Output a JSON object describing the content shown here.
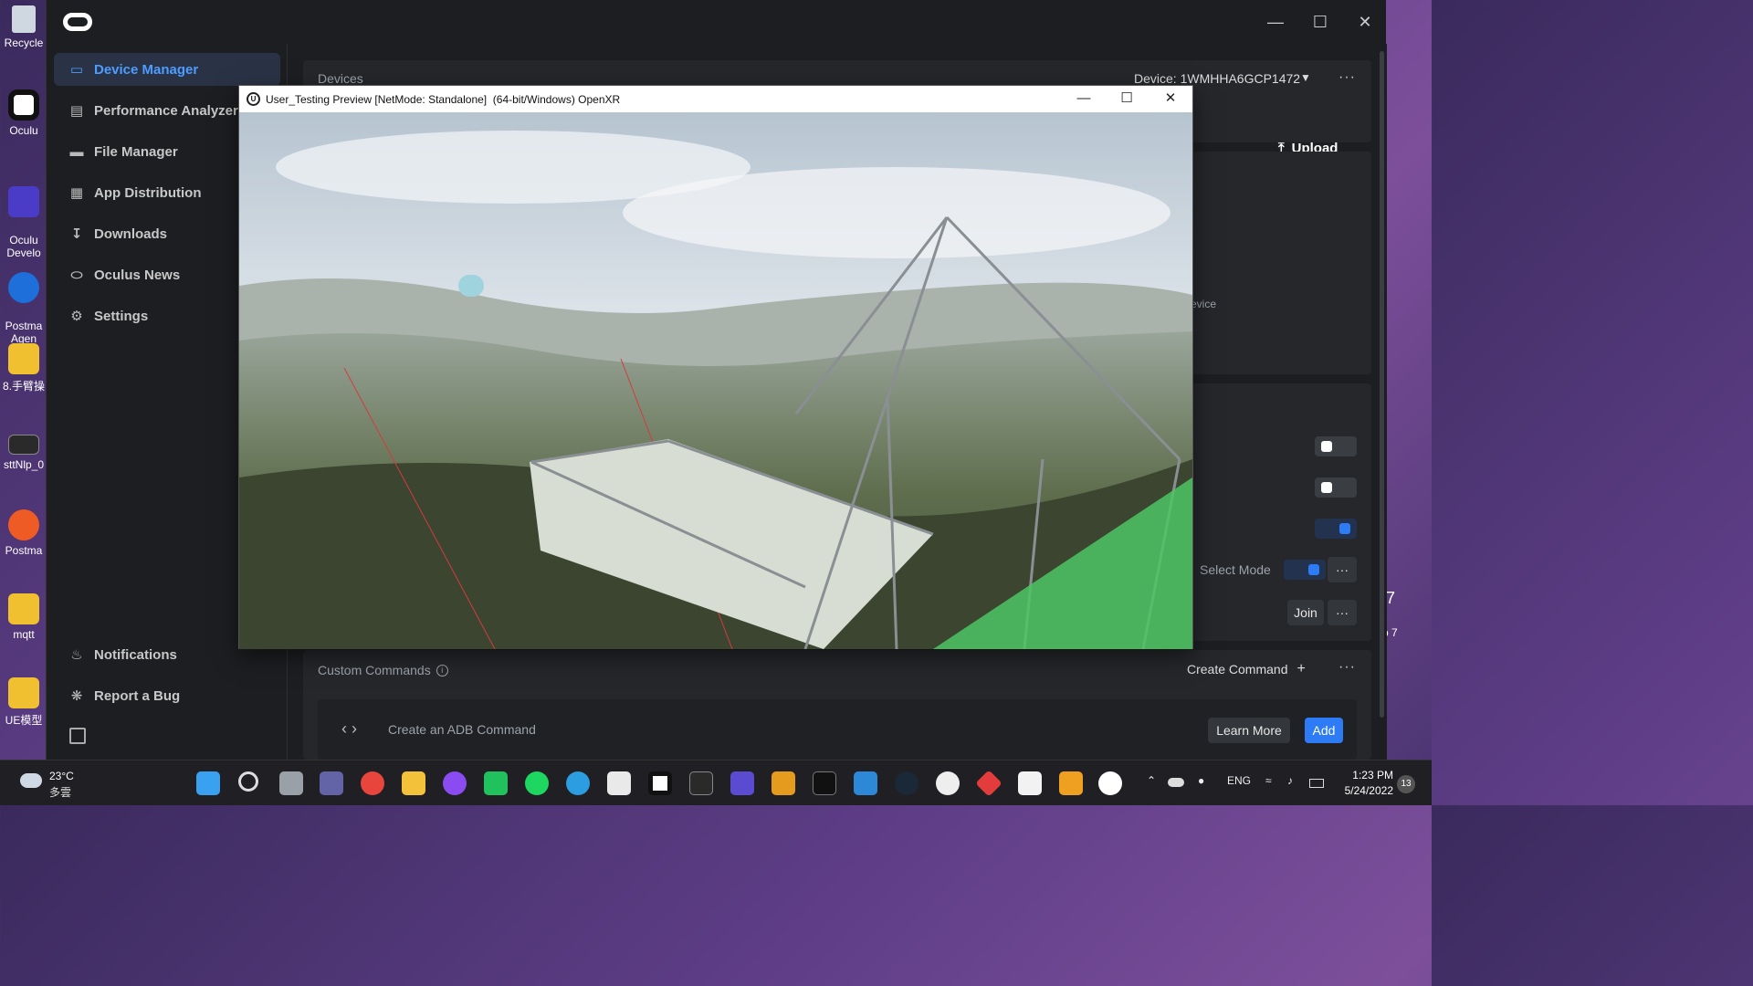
{
  "desktop": {
    "icons": [
      {
        "label": "Recycle"
      },
      {
        "label": "Oculu"
      },
      {
        "label": "Oculu\nDevelo"
      },
      {
        "label": "Postma\nAgen"
      },
      {
        "label": "8.手臂操"
      },
      {
        "label": "sttNlp_0"
      },
      {
        "label": "Postma"
      },
      {
        "label": "mqtt"
      },
      {
        "label": "UE模型"
      }
    ],
    "right_edge_text": [
      "7",
      "p 7"
    ]
  },
  "oculus": {
    "nav": [
      {
        "label": "Device Manager",
        "icon": "headset-icon",
        "active": true
      },
      {
        "label": "Performance Analyzer",
        "icon": "chart-icon"
      },
      {
        "label": "File Manager",
        "icon": "folder-icon"
      },
      {
        "label": "App Distribution",
        "icon": "grid-icon"
      },
      {
        "label": "Downloads",
        "icon": "download-icon"
      },
      {
        "label": "Oculus News",
        "icon": "oculus-icon"
      },
      {
        "label": "Settings",
        "icon": "gear-icon"
      }
    ],
    "bottom_nav": [
      {
        "label": "Notifications",
        "icon": "bell-icon"
      },
      {
        "label": "Report a Bug",
        "icon": "bug-icon"
      }
    ],
    "devices_label": "Devices",
    "device_select": "Device: 1WMHHA6GCP1472",
    "upload_label": "Upload",
    "partial_text_evice": "evice",
    "select_mode_label": "Select Mode",
    "join_label": "Join",
    "custom_commands_label": "Custom Commands",
    "create_command_label": "Create Command",
    "adb_command_label": "Create an ADB Command",
    "learn_more_label": "Learn More",
    "add_label": "Add",
    "more_label": "···"
  },
  "unreal": {
    "title": "User_Testing Preview [NetMode: Standalone]  (64-bit/Windows) OpenXR"
  },
  "taskbar": {
    "weather_temp": "23°C",
    "weather_desc": "多雲",
    "lang": "ENG",
    "time": "1:23 PM",
    "date": "5/24/2022",
    "notif_count": "13"
  },
  "colors": {
    "accent_blue": "#4d9cff",
    "add_button": "#2d7cf6",
    "app_bg": "#1c1e21"
  }
}
